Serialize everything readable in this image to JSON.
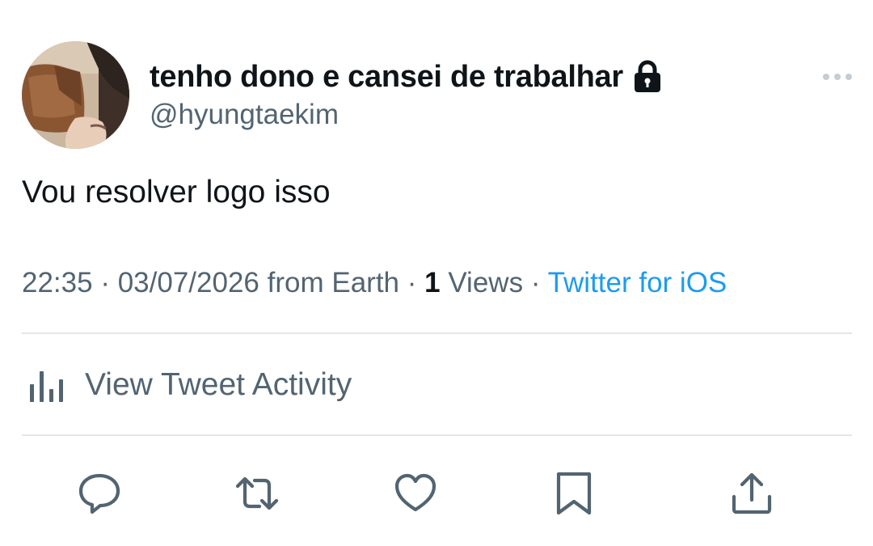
{
  "author": {
    "display_name": "tenho dono e cansei de trabalhar",
    "handle": "@hyungtaekim",
    "protected_icon": "lock-icon"
  },
  "tweet": {
    "text": "Vou resolver logo isso"
  },
  "meta": {
    "time": "22:35",
    "separator": "·",
    "date": "03/07/2026",
    "location": "from Earth",
    "views_count": "1",
    "views_label": "Views",
    "source": "Twitter for iOS"
  },
  "activity": {
    "label": "View Tweet Activity",
    "icon": "bar-chart-icon"
  },
  "actions": [
    {
      "name": "reply",
      "icon": "reply-icon"
    },
    {
      "name": "retweet",
      "icon": "retweet-icon"
    },
    {
      "name": "like",
      "icon": "heart-icon"
    },
    {
      "name": "bookmark",
      "icon": "bookmark-icon"
    },
    {
      "name": "share",
      "icon": "share-icon"
    }
  ],
  "colors": {
    "text_primary": "#0f1419",
    "text_secondary": "#536471",
    "link": "#1d9bf0",
    "divider": "#e3e6e9"
  }
}
